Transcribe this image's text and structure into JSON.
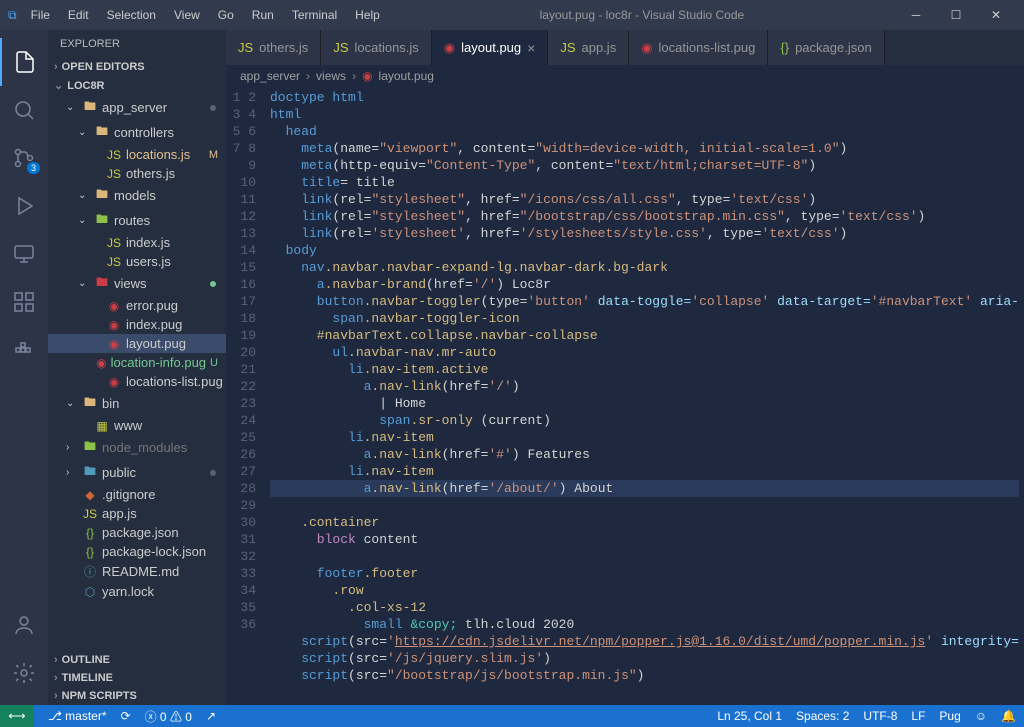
{
  "titlebar": {
    "menu": [
      "File",
      "Edit",
      "Selection",
      "View",
      "Go",
      "Run",
      "Terminal",
      "Help"
    ],
    "title": "layout.pug - loc8r - Visual Studio Code"
  },
  "activitybar": {
    "sourceControlBadge": "3"
  },
  "sidebar": {
    "title": "EXPLORER",
    "sections": {
      "openEditors": "OPEN EDITORS",
      "project": "LOC8R",
      "outline": "OUTLINE",
      "timeline": "TIMELINE",
      "npm": "NPM SCRIPTS"
    },
    "tree": {
      "app_server": "app_server",
      "controllers": "controllers",
      "locations_js": "locations.js",
      "others_js": "others.js",
      "models": "models",
      "routes": "routes",
      "index_js": "index.js",
      "users_js": "users.js",
      "views": "views",
      "error_pug": "error.pug",
      "index_pug": "index.pug",
      "layout_pug": "layout.pug",
      "location_info_pug": "location-info.pug",
      "locations_list_pug": "locations-list.pug",
      "bin": "bin",
      "www": "www",
      "node_modules": "node_modules",
      "public": "public",
      "gitignore": ".gitignore",
      "app_js": "app.js",
      "package_json": "package.json",
      "package_lock": "package-lock.json",
      "readme": "README.md",
      "yarn_lock": "yarn.lock"
    }
  },
  "tabs": [
    {
      "label": "others.js",
      "icon": "js"
    },
    {
      "label": "locations.js",
      "icon": "js"
    },
    {
      "label": "layout.pug",
      "icon": "pug",
      "active": true
    },
    {
      "label": "app.js",
      "icon": "js"
    },
    {
      "label": "locations-list.pug",
      "icon": "pug"
    },
    {
      "label": "package.json",
      "icon": "json"
    }
  ],
  "breadcrumb": {
    "p1": "app_server",
    "p2": "views",
    "p3": "layout.pug"
  },
  "code": {
    "l1": "doctype html",
    "l2": "html",
    "l3": "  head",
    "l4_a": "    meta",
    "l4_b": "(name=",
    "l4_c": "\"viewport\"",
    "l4_d": ", content=",
    "l4_e": "\"width=device-width, initial-scale=1.0\"",
    "l4_f": ")",
    "l5_a": "    meta",
    "l5_b": "(http-equiv=",
    "l5_c": "\"Content-Type\"",
    "l5_d": ", content=",
    "l5_e": "\"text/html;charset=UTF-8\"",
    "l5_f": ")",
    "l6_a": "    title",
    "l6_b": "= title",
    "l7_a": "    link",
    "l7_b": "(rel=",
    "l7_c": "\"stylesheet\"",
    "l7_d": ", href=",
    "l7_e": "\"/icons/css/all.css\"",
    "l7_f": ", type=",
    "l7_g": "'text/css'",
    "l7_h": ")",
    "l8_a": "    link",
    "l8_b": "(rel=",
    "l8_c": "\"stylesheet\"",
    "l8_d": ", href=",
    "l8_e": "\"/bootstrap/css/bootstrap.min.css\"",
    "l8_f": ", type=",
    "l8_g": "'text/css'",
    "l8_h": ")",
    "l9_a": "    link",
    "l9_b": "(rel=",
    "l9_c": "'stylesheet'",
    "l9_d": ", href=",
    "l9_e": "'/stylesheets/style.css'",
    "l9_f": ", type=",
    "l9_g": "'text/css'",
    "l9_h": ")",
    "l10": "  body",
    "l11_a": "    nav",
    "l11_b": ".navbar.navbar-expand-lg.navbar-dark.bg-dark",
    "l12_a": "      a",
    "l12_b": ".navbar-brand",
    "l12_c": "(href=",
    "l12_d": "'/'",
    "l12_e": ")",
    "l12_f": " Loc8r",
    "l13_a": "      button",
    "l13_b": ".navbar-toggler",
    "l13_c": "(type=",
    "l13_d": "'button'",
    "l13_e": " data-toggle=",
    "l13_f": "'collapse'",
    "l13_g": " data-target=",
    "l13_h": "'#navbarText'",
    "l13_i": " aria-",
    "l14_a": "        span",
    "l14_b": ".navbar-toggler-icon",
    "l15_a": "      #navbarText",
    "l15_b": ".collapse.navbar-collapse",
    "l16_a": "        ul",
    "l16_b": ".navbar-nav.mr-auto",
    "l17_a": "          li",
    "l17_b": ".nav-item.active",
    "l18_a": "            a",
    "l18_b": ".nav-link",
    "l18_c": "(href=",
    "l18_d": "'/'",
    "l18_e": ")",
    "l19": "              | Home",
    "l20_a": "              span",
    "l20_b": ".sr-only",
    "l20_c": " (current)",
    "l21_a": "          li",
    "l21_b": ".nav-item",
    "l22_a": "            a",
    "l22_b": ".nav-link",
    "l22_c": "(href=",
    "l22_d": "'#'",
    "l22_e": ")",
    "l22_f": " Features",
    "l23_a": "          li",
    "l23_b": ".nav-item",
    "l24_a": "            a",
    "l24_b": ".nav-link",
    "l24_c": "(href=",
    "l24_d": "'/about/'",
    "l24_e": ")",
    "l24_f": " About",
    "l26_a": "    .container",
    "l27_a": "      block",
    "l27_b": " content",
    "l29_a": "      footer",
    "l29_b": ".footer",
    "l30_a": "        .row",
    "l31_a": "          .col-xs-12",
    "l32_a": "            small ",
    "l32_b": "&copy;",
    "l32_c": " tlh.cloud 2020",
    "l33_a": "    script",
    "l33_b": "(src=",
    "l33_c": "'",
    "l33_url": "https://cdn.jsdelivr.net/npm/popper.js@1.16.0/dist/umd/popper.min.js",
    "l33_d": "'",
    "l33_e": " integrity=",
    "l34_a": "    script",
    "l34_b": "(src=",
    "l34_c": "'/js/jquery.slim.js'",
    "l34_d": ")",
    "l35_a": "    script",
    "l35_b": "(src=",
    "l35_c": "\"/bootstrap/js/bootstrap.min.js\"",
    "l35_d": ")"
  },
  "statusbar": {
    "branch": "master*",
    "errors": "0",
    "warnings": "0",
    "lncol": "Ln 25, Col 1",
    "spaces": "Spaces: 2",
    "encoding": "UTF-8",
    "eol": "LF",
    "lang": "Pug",
    "feedback": "☺"
  }
}
